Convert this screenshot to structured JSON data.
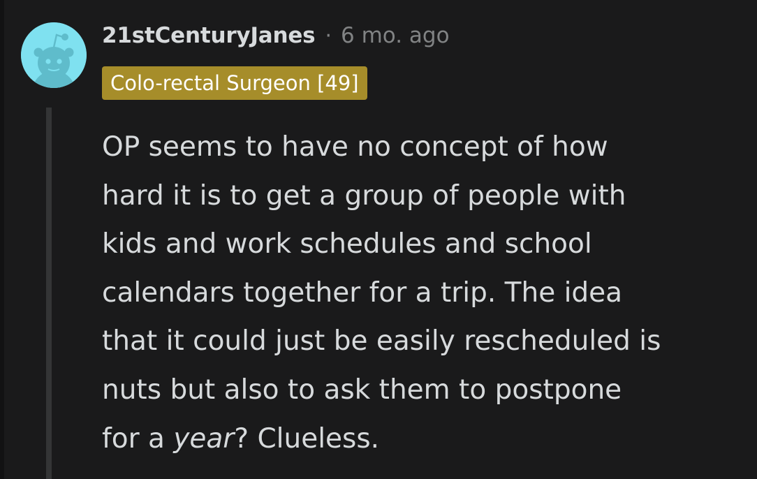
{
  "comment": {
    "username": "21stCenturyJanes",
    "separator": "·",
    "timestamp": "6 mo. ago",
    "flair": "Colo-rectal Surgeon [49]",
    "avatar_icon": "snoo-avatar-icon",
    "body_lines": [
      "OP seems to have no concept of how",
      "hard it is to get a group of people with",
      "kids and work schedules and school",
      "calendars together for a trip. The idea",
      "that it could just be easily rescheduled is",
      "nuts but also to ask them to postpone"
    ],
    "last_line": {
      "before": "for a ",
      "emphasis": "year",
      "after": "? Clueless."
    }
  },
  "colors": {
    "background": "#1a1a1b",
    "text": "#d7dadc",
    "meta": "#818384",
    "flair_bg": "#a68d2a",
    "avatar_bg": "#7fe1f0"
  }
}
